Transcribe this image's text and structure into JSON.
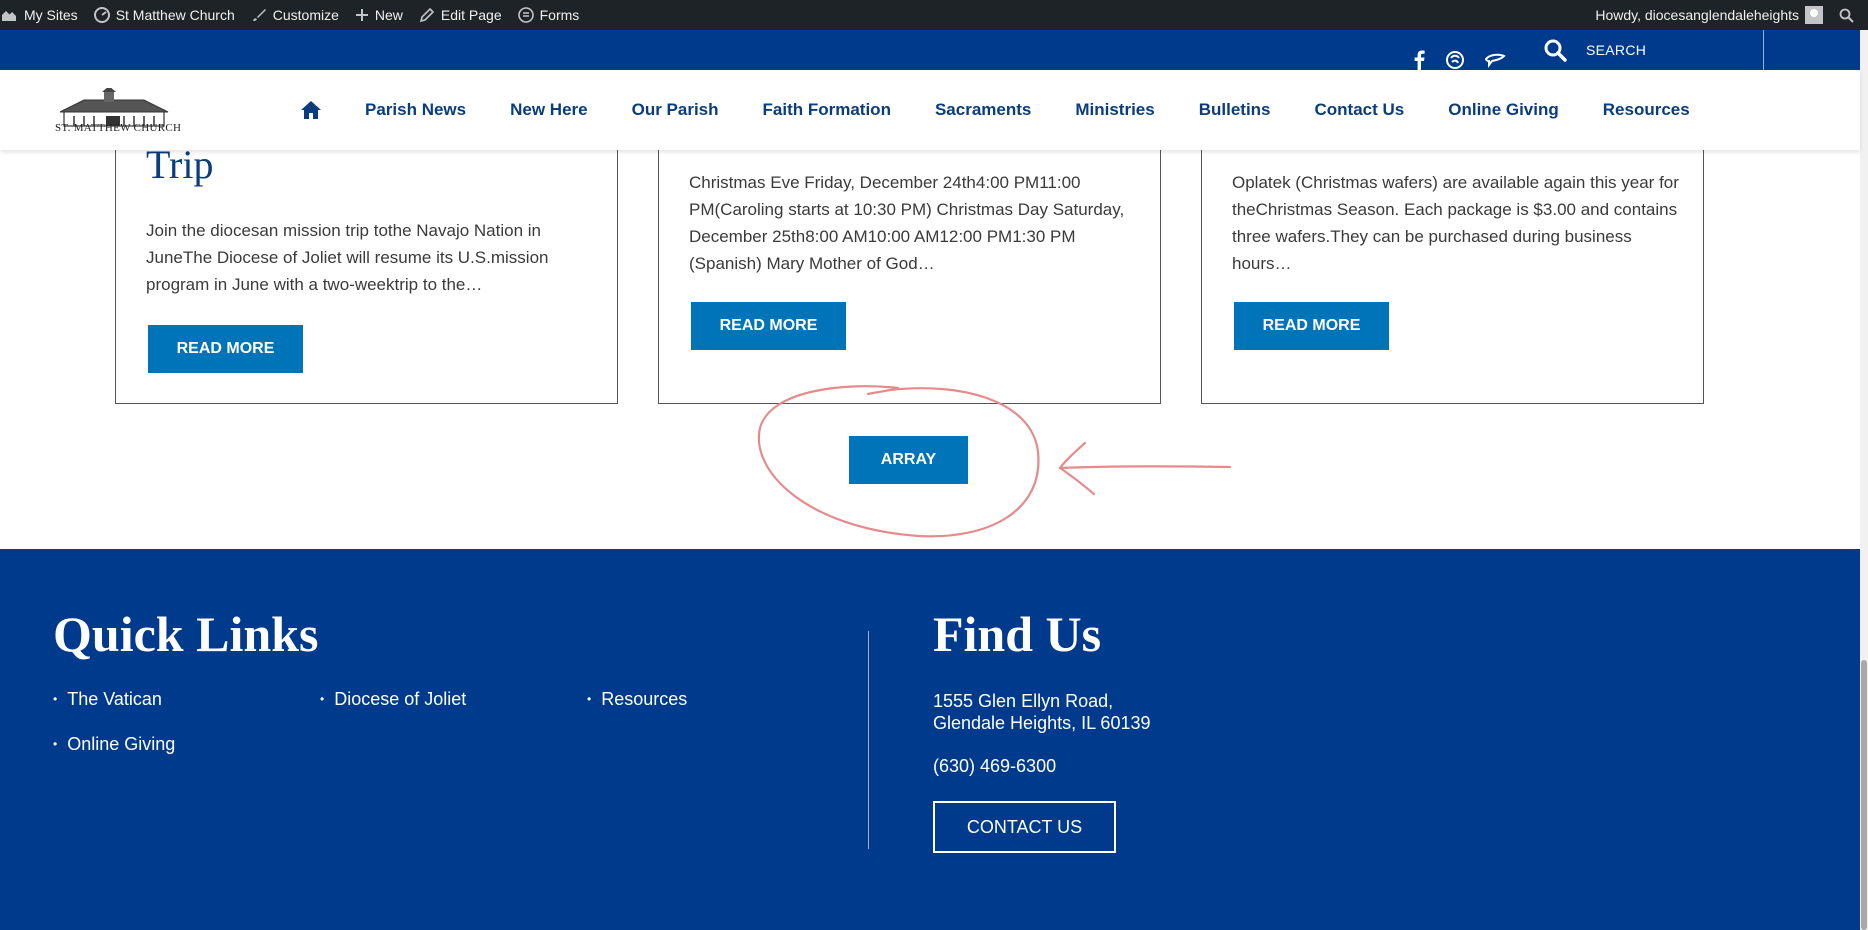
{
  "admin_bar": {
    "my_sites": "My Sites",
    "site_name": "St Matthew Church",
    "customize": "Customize",
    "new": "New",
    "edit_page": "Edit Page",
    "forms": "Forms",
    "howdy": "Howdy, diocesanglendaleheights"
  },
  "top_bar": {
    "search_label": "SEARCH",
    "icons": [
      "facebook-icon",
      "flocknote-icon",
      "chat-icon",
      "search-icon"
    ]
  },
  "nav": {
    "logo_text": "ST. MATTHEW CHURCH",
    "home_icon": "home-icon",
    "items": [
      "Parish News",
      "New Here",
      "Our Parish",
      "Faith Formation",
      "Sacraments",
      "Ministries",
      "Bulletins",
      "Contact Us",
      "Online Giving",
      "Resources"
    ]
  },
  "cards": [
    {
      "title": "Trip",
      "text": "Join the diocesan mission trip tothe Navajo Nation in JuneThe Diocese of Joliet will resume its U.S.mission program in June with a two-weektrip to the…",
      "button": "READ MORE"
    },
    {
      "title": "",
      "text": "Christmas Eve Friday, December 24th4:00 PM11:00 PM(Caroling starts at 10:30 PM) Christmas Day Saturday, December 25th8:00 AM10:00 AM12:00 PM1:30 PM (Spanish) Mary Mother of God…",
      "button": "READ MORE"
    },
    {
      "title": "",
      "text": "Oplatek (Christmas wafers) are available again this year for theChristmas Season. Each package is $3.00 and contains three wafers.They can be purchased during business hours…",
      "button": "READ MORE"
    }
  ],
  "array_button": "ARRAY",
  "footer": {
    "quick_links_heading": "Quick Links",
    "quick_links": [
      "The Vatican",
      "Diocese of Joliet",
      "Resources",
      "Online Giving"
    ],
    "find_us_heading": "Find Us",
    "address_line1": "1555 Glen Ellyn Road,",
    "address_line2": "Glendale Heights, IL 60139",
    "phone": "(630) 469-6300",
    "contact_button": "CONTACT US"
  },
  "colors": {
    "primary_blue": "#003a8c",
    "button_blue": "#0074b8",
    "nav_text": "#0b3c7d",
    "admin_bar": "#1d2327",
    "annotation_red": "#e58b8b"
  }
}
